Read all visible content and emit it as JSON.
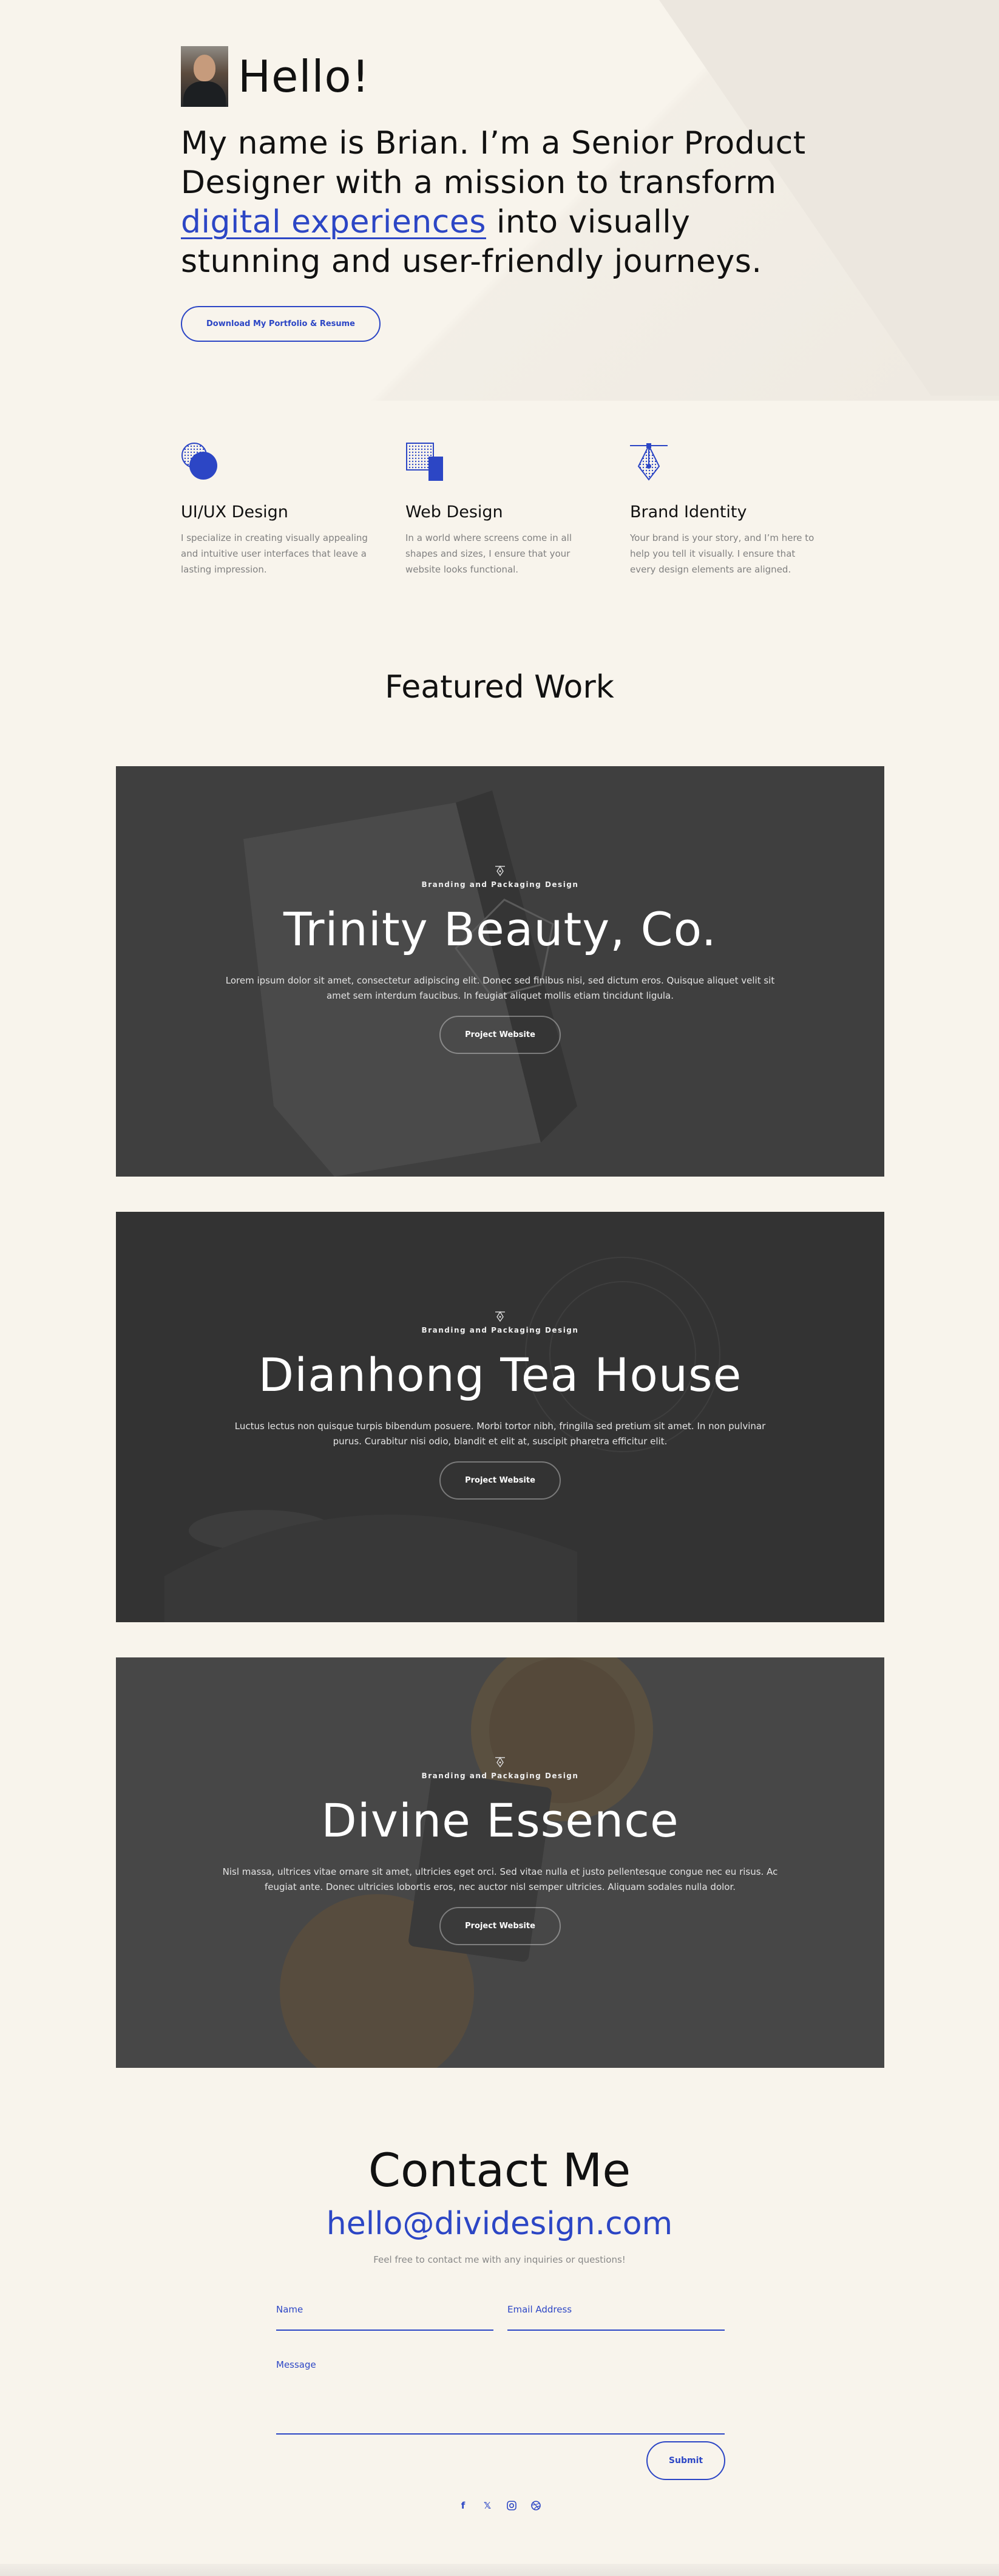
{
  "hero": {
    "greeting": "Hello!",
    "intro_before": "My name is Brian. I’m a Senior Product Designer with a mission to transform ",
    "intro_highlight": "digital experiences",
    "intro_after": " into visually stunning and user-friendly journeys.",
    "cta_label": "Download My Portfolio & Resume"
  },
  "services": [
    {
      "icon": "ui-ux-icon",
      "title": "UI/UX Design",
      "text": "I specialize in creating visually appealing and intuitive user interfaces that leave a lasting impression."
    },
    {
      "icon": "web-design-icon",
      "title": "Web Design",
      "text": "In a world where screens come in all shapes and sizes, I ensure that your website looks functional."
    },
    {
      "icon": "pen-nib-icon",
      "title": "Brand Identity",
      "text": "Your brand is your story, and I’m here to help you tell it visually. I ensure that every design elements are aligned."
    }
  ],
  "featured": {
    "title": "Featured Work",
    "projects": [
      {
        "category": "Branding and Packaging Design",
        "title": "Trinity Beauty, Co.",
        "text": "Lorem ipsum dolor sit amet, consectetur adipiscing elit. Donec sed finibus nisi, sed dictum eros. Quisque aliquet velit sit amet sem interdum faucibus. In feugiat aliquet mollis etiam tincidunt ligula.",
        "button": "Project Website"
      },
      {
        "category": "Branding and Packaging Design",
        "title": "Dianhong Tea House",
        "text": "Luctus lectus non quisque turpis bibendum posuere. Morbi tortor nibh, fringilla sed pretium sit amet. In non pulvinar purus. Curabitur nisi odio, blandit et elit at, suscipit pharetra efficitur elit.",
        "button": "Project Website"
      },
      {
        "category": "Branding and Packaging Design",
        "title": "Divine Essence",
        "text": "Nisl massa, ultrices vitae ornare sit amet, ultricies eget orci. Sed vitae nulla et justo pellentesque congue nec eu risus. Ac feugiat ante. Donec ultricies lobortis eros, nec auctor nisl semper ultricies. Aliquam sodales nulla dolor.",
        "button": "Project Website"
      }
    ]
  },
  "contact": {
    "title": "Contact Me",
    "email": "hello@dividesign.com",
    "note": "Feel free to contact me with any inquiries or questions!",
    "name_label": "Name",
    "email_label": "Email Address",
    "message_label": "Message",
    "submit_label": "Submit"
  },
  "social": [
    "facebook-icon",
    "x-icon",
    "instagram-icon",
    "dribbble-icon"
  ],
  "colors": {
    "accent": "#2c46c5",
    "background": "#f8f4ec"
  }
}
